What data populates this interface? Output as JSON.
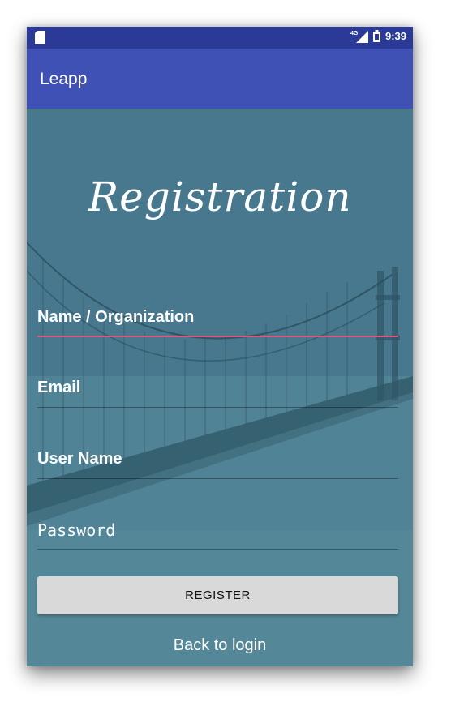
{
  "status_bar": {
    "network": "4G",
    "time": "9:39"
  },
  "app_bar": {
    "title": "Leapp"
  },
  "main": {
    "title": "Registration",
    "fields": {
      "name": "Name / Organization",
      "email": "Email",
      "username": "User Name",
      "password": "Password"
    },
    "register_label": "REGISTER",
    "back_link": "Back to login"
  },
  "colors": {
    "status_bar": "#2c3a97",
    "app_bar": "#3f51b5",
    "background": "#4b7f93",
    "focus_underline": "#e0567f",
    "button_bg": "#d9d9d9"
  }
}
